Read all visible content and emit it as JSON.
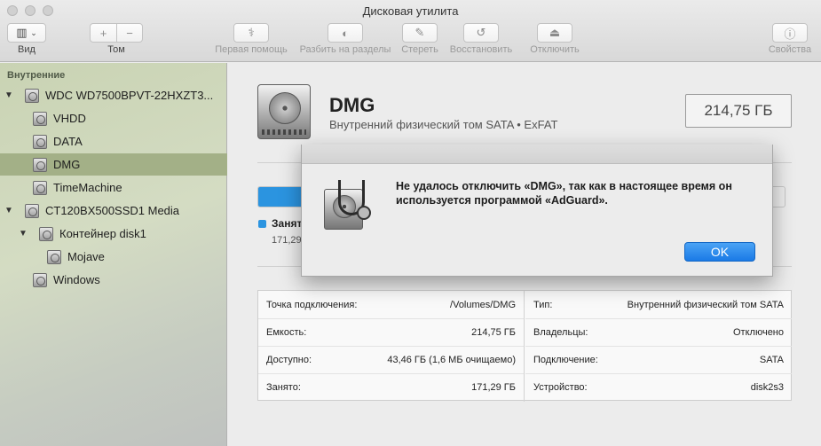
{
  "window": {
    "title": "Дисковая утилита"
  },
  "toolbar": {
    "view_label": "Вид",
    "volume_label": "Том",
    "first_aid_label": "Первая помощь",
    "partition_label": "Разбить на разделы",
    "erase_label": "Стереть",
    "restore_label": "Восстановить",
    "unmount_label": "Отключить",
    "info_label": "Свойства",
    "add_glyph": "+",
    "remove_glyph": "−"
  },
  "sidebar": {
    "section_label": "Внутренние",
    "items": [
      {
        "label": "WDC WD7500BPVT-22HXZT3...",
        "icon": "hard-drive-icon"
      },
      {
        "label": "VHDD",
        "icon": "hard-drive-icon"
      },
      {
        "label": "DATA",
        "icon": "hard-drive-icon"
      },
      {
        "label": "DMG",
        "icon": "hard-drive-icon",
        "selected": true
      },
      {
        "label": "TimeMachine",
        "icon": "hard-drive-icon"
      },
      {
        "label": "CT120BX500SSD1 Media",
        "icon": "hard-drive-icon"
      },
      {
        "label": "Контейнер disk1",
        "icon": "hard-drive-icon"
      },
      {
        "label": "Mojave",
        "icon": "hard-drive-icon"
      },
      {
        "label": "Windows",
        "icon": "hard-drive-icon"
      }
    ]
  },
  "volume": {
    "name": "DMG",
    "description": "Внутренний физический том SATA • ExFAT",
    "size": "214,75 ГБ",
    "used_fraction": 0.8,
    "used_label": "Занят",
    "used_value": "171,29"
  },
  "info": {
    "left": [
      {
        "key": "Точка подключения:",
        "value": "/Volumes/DMG"
      },
      {
        "key": "Емкость:",
        "value": "214,75 ГБ"
      },
      {
        "key": "Доступно:",
        "value": "43,46 ГБ (1,6 МБ очищаемо)"
      },
      {
        "key": "Занято:",
        "value": "171,29 ГБ"
      }
    ],
    "right": [
      {
        "key": "Тип:",
        "value": "Внутренний физический том SATA"
      },
      {
        "key": "Владельцы:",
        "value": "Отключено"
      },
      {
        "key": "Подключение:",
        "value": "SATA"
      },
      {
        "key": "Устройство:",
        "value": "disk2s3"
      }
    ]
  },
  "alert": {
    "message": "Не удалось отключить «DMG», так как в настоящее время он используется программой «AdGuard».",
    "ok_label": "OK",
    "accent": "#1a7ae6"
  }
}
